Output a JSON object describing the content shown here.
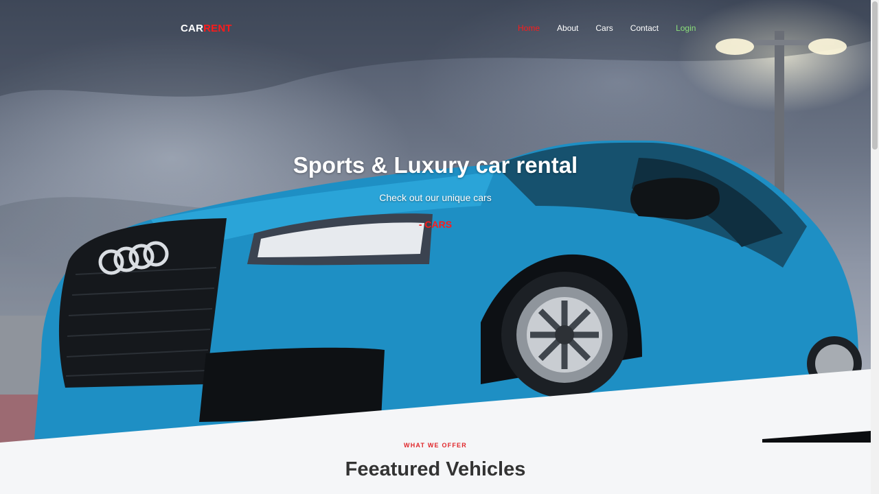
{
  "brand": {
    "part1": "CAR",
    "part2": "RENT"
  },
  "nav": {
    "items": [
      {
        "label": "Home",
        "active": true
      },
      {
        "label": "About"
      },
      {
        "label": "Cars"
      },
      {
        "label": "Contact"
      },
      {
        "label": "Login"
      }
    ]
  },
  "hero": {
    "title": "Sports & Luxury car rental",
    "subtitle": "Check out our unique cars",
    "tagline": "- CARS"
  },
  "section": {
    "eyebrow": "WHAT WE OFFER",
    "heading": "Feeatured Vehicles"
  },
  "colors": {
    "accent": "#ff1a1a",
    "login": "#8be07a",
    "car_body": "#1e8fc4",
    "page_bg": "#f5f6f8"
  }
}
